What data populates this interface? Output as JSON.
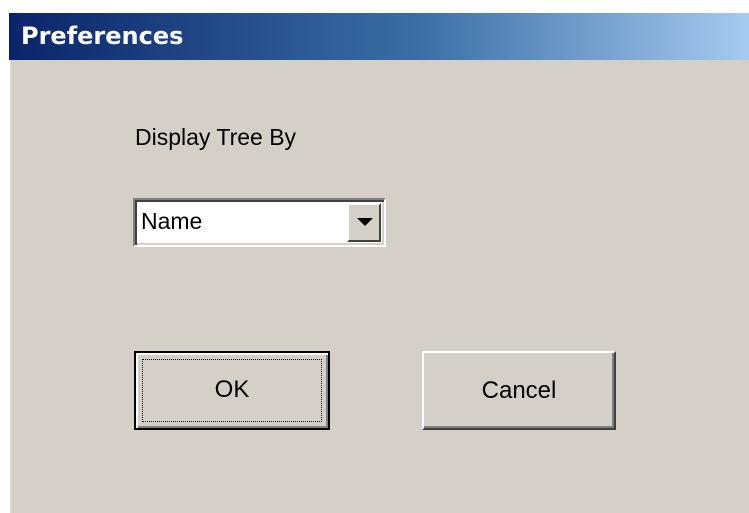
{
  "window": {
    "title": "Preferences"
  },
  "form": {
    "label": "Display Tree By",
    "select": {
      "selected_value": "Name",
      "arrow_icon": "chevron-down-icon"
    }
  },
  "buttons": {
    "ok_label": "OK",
    "cancel_label": "Cancel"
  },
  "colors": {
    "dialog_background": "#d4d0c8",
    "titlebar_start": "#0a246a",
    "titlebar_end": "#a6caf0",
    "title_text": "#ffffff"
  }
}
